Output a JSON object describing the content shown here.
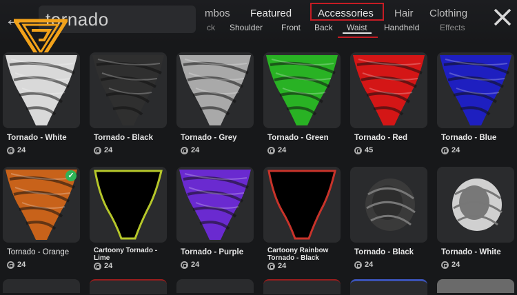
{
  "search": {
    "query": "tornado"
  },
  "tabs": [
    {
      "label": "mbos"
    },
    {
      "label": "Featured"
    },
    {
      "label": "Accessories"
    },
    {
      "label": "Hair"
    },
    {
      "label": "Clothing"
    }
  ],
  "subtabs": [
    {
      "label": "ck"
    },
    {
      "label": "Shoulder"
    },
    {
      "label": "Front"
    },
    {
      "label": "Back"
    },
    {
      "label": "Waist"
    },
    {
      "label": "Handheld"
    },
    {
      "label": "Effects"
    }
  ],
  "items": [
    {
      "name": "Tornado - White",
      "price": "24",
      "color": "#d9d9d9"
    },
    {
      "name": "Tornado - Black",
      "price": "24",
      "color": "#2f2f2f"
    },
    {
      "name": "Tornado - Grey",
      "price": "24",
      "color": "#a9a9a9"
    },
    {
      "name": "Tornado - Green",
      "price": "24",
      "color": "#29b224"
    },
    {
      "name": "Tornado - Red",
      "price": "45",
      "color": "#d41616"
    },
    {
      "name": "Tornado - Blue",
      "price": "24",
      "color": "#1e1fc0"
    },
    {
      "name": "Tornado - Orange",
      "price": "24",
      "color": "#c8621a"
    },
    {
      "name": "Cartoony Tornado - Lime",
      "price": "24",
      "color": "#b6c72a"
    },
    {
      "name": "Tornado - Purple",
      "price": "24",
      "color": "#6a2ad0"
    },
    {
      "name": "Cartoony Rainbow Tornado - Black",
      "price": "24",
      "color": "#c8332a"
    },
    {
      "name": "Tornado - Black",
      "price": "24",
      "color": "#3a3a3a"
    },
    {
      "name": "Tornado - White",
      "price": "24",
      "color": "#d0d0d0"
    }
  ],
  "colors": {
    "accent": "#c61c24",
    "owned": "#2fb457",
    "logo": "#f2a21a"
  }
}
